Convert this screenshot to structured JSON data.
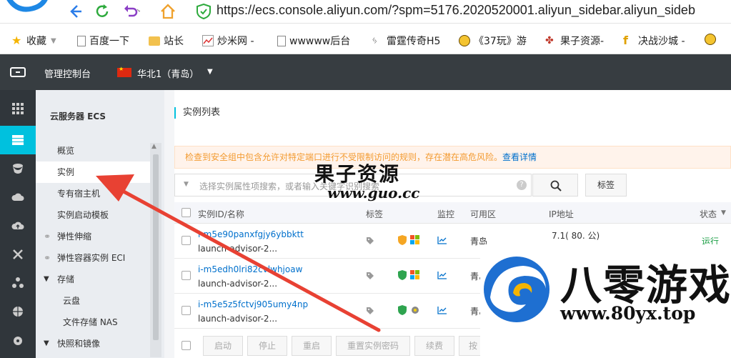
{
  "browser": {
    "url": "https://ecs.console.aliyun.com/?spm=5176.2020520001.aliyun_sidebar.aliyun_sideb",
    "bookmarks": [
      {
        "label": "收藏",
        "icon": "star-icon"
      },
      {
        "label": "百度一下",
        "icon": "page-icon"
      },
      {
        "label": "站长",
        "icon": "folder-icon"
      },
      {
        "label": "炒米网 -",
        "icon": "chart-icon"
      },
      {
        "label": "wwwww后台",
        "icon": "page-icon"
      },
      {
        "label": "雷霆传奇H5",
        "icon": "figure-icon"
      },
      {
        "label": "《37玩》游",
        "icon": "smiley-icon"
      },
      {
        "label": "果子资源-",
        "icon": "puzzle-icon"
      },
      {
        "label": "决战沙城 -",
        "icon": "f-icon"
      }
    ]
  },
  "topbar": {
    "title": "管理控制台",
    "region": "华北1（青岛）"
  },
  "sidebar": {
    "title": "云服务器 ECS",
    "items": [
      {
        "label": "概览"
      },
      {
        "label": "实例"
      },
      {
        "label": "专有宿主机"
      },
      {
        "label": "实例启动模板"
      },
      {
        "label": "弹性伸缩"
      },
      {
        "label": "弹性容器实例 ECI"
      },
      {
        "label": "存储"
      },
      {
        "label": "云盘"
      },
      {
        "label": "文件存储 NAS"
      },
      {
        "label": "快照和镜像"
      }
    ]
  },
  "main": {
    "breadcrumb": "实例列表",
    "warning": "检查到安全组中包含允许对特定端口进行不受限制访问的规则，存在潜在高危风险。",
    "warning_link": "查看详情",
    "search_placeholder": "选择实例属性项搜索，或者输入关键字识别搜索",
    "tag_button": "标签",
    "columns": [
      "实例ID/名称",
      "标签",
      "监控",
      "可用区",
      "IP地址",
      "状态"
    ],
    "rows": [
      {
        "id": "i-m5e90panxfgjy6ybbktt",
        "name": "launch-advisor-2...",
        "zone": "青岛",
        "ip": "7.1(   80.   公)",
        "status": "运行"
      },
      {
        "id": "i-m5edh0lri82cvlwhjoaw",
        "name": "launch-advisor-2...",
        "zone": "青岛",
        "ip": "",
        "status": ""
      },
      {
        "id": "i-m5e5z5fctvj905umy4np",
        "name": "launch-advisor-2...",
        "zone": "青岛",
        "ip": "",
        "status": ""
      }
    ],
    "footer_buttons": [
      "启动",
      "停止",
      "重启",
      "重置实例密码",
      "续费",
      "按"
    ]
  },
  "watermarks": {
    "wm1_title": "果子资源",
    "wm1_url": "www.guo.cc",
    "wm2_title": "八零游戏",
    "wm2_url": "www.80yx.top"
  },
  "colors": {
    "accent": "#00c1de",
    "topbar": "#373d41",
    "rail": "#30363b",
    "sidebar": "#eaedf1",
    "link": "#0070cc",
    "warning": "#f39b31",
    "annotation": "#e84133"
  }
}
